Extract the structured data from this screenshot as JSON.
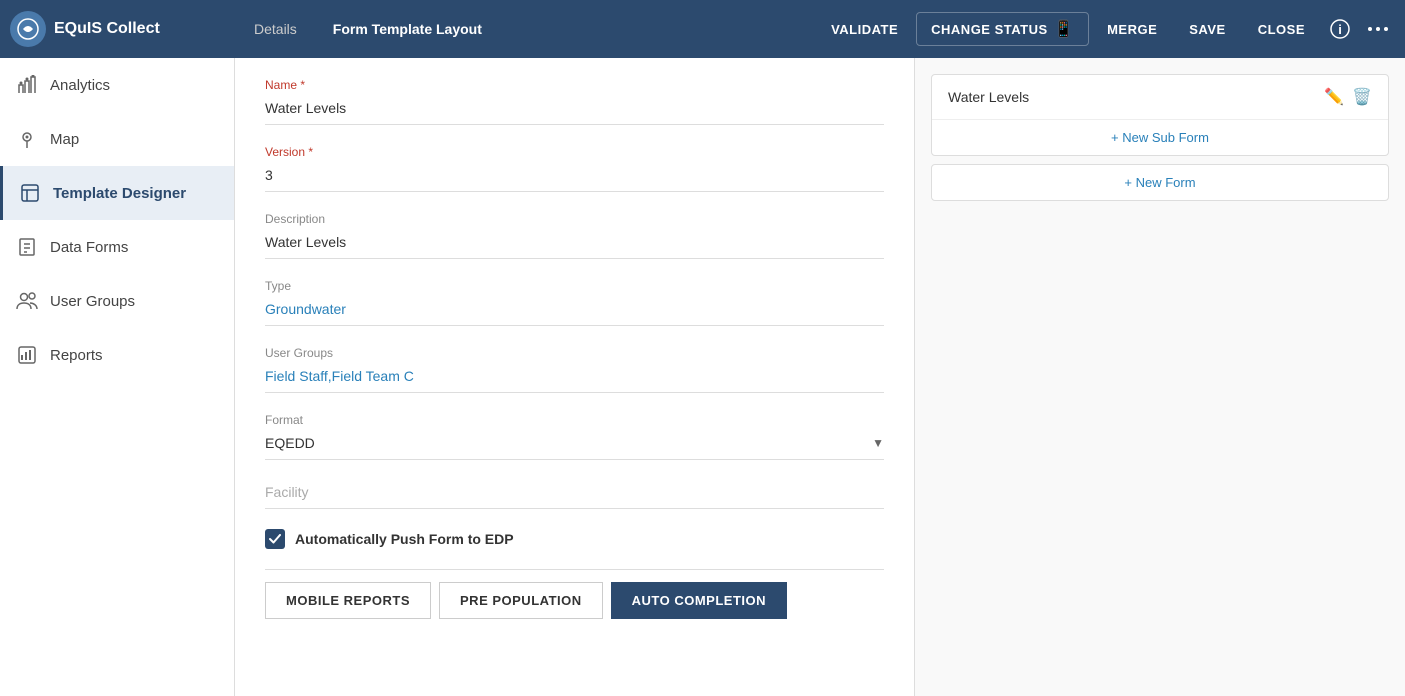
{
  "app": {
    "logo_text": "EQuIS Collect",
    "logo_icon": "◉"
  },
  "header": {
    "tabs": [
      {
        "id": "details",
        "label": "Details",
        "active": false
      },
      {
        "id": "form-template-layout",
        "label": "Form Template Layout",
        "active": true
      }
    ],
    "buttons": [
      {
        "id": "validate",
        "label": "VALIDATE"
      },
      {
        "id": "change-status",
        "label": "CHANGE STATUS"
      },
      {
        "id": "merge",
        "label": "MERGE"
      },
      {
        "id": "save",
        "label": "SAVE"
      },
      {
        "id": "close",
        "label": "CLOSE"
      }
    ]
  },
  "sidebar": {
    "items": [
      {
        "id": "analytics",
        "label": "Analytics",
        "icon": "◔"
      },
      {
        "id": "map",
        "label": "Map",
        "icon": "👤"
      },
      {
        "id": "template-designer",
        "label": "Template Designer",
        "icon": "📋",
        "active": true
      },
      {
        "id": "data-forms",
        "label": "Data Forms",
        "icon": "📄"
      },
      {
        "id": "user-groups",
        "label": "User Groups",
        "icon": "👥"
      },
      {
        "id": "reports",
        "label": "Reports",
        "icon": "📊"
      }
    ]
  },
  "form": {
    "name_label": "Name *",
    "name_value": "Water Levels",
    "version_label": "Version *",
    "version_value": "3",
    "description_label": "Description",
    "description_value": "Water Levels",
    "type_label": "Type",
    "type_value": "Groundwater",
    "user_groups_label": "User Groups",
    "user_groups_value": "Field Staff,Field Team C",
    "format_label": "Format",
    "format_value": "EQEDD",
    "facility_label": "Facility",
    "facility_placeholder": "Facility",
    "auto_push_label": "Automatically Push Form to EDP",
    "buttons": [
      {
        "id": "mobile-reports",
        "label": "MOBILE REPORTS",
        "active": false
      },
      {
        "id": "pre-population",
        "label": "PRE POPULATION",
        "active": false
      },
      {
        "id": "auto-completion",
        "label": "AUTO COMPLETION",
        "active": true
      }
    ]
  },
  "right_panel": {
    "form_title": "Water Levels",
    "new_sub_form_label": "+ New Sub Form",
    "new_form_label": "+ New Form"
  }
}
